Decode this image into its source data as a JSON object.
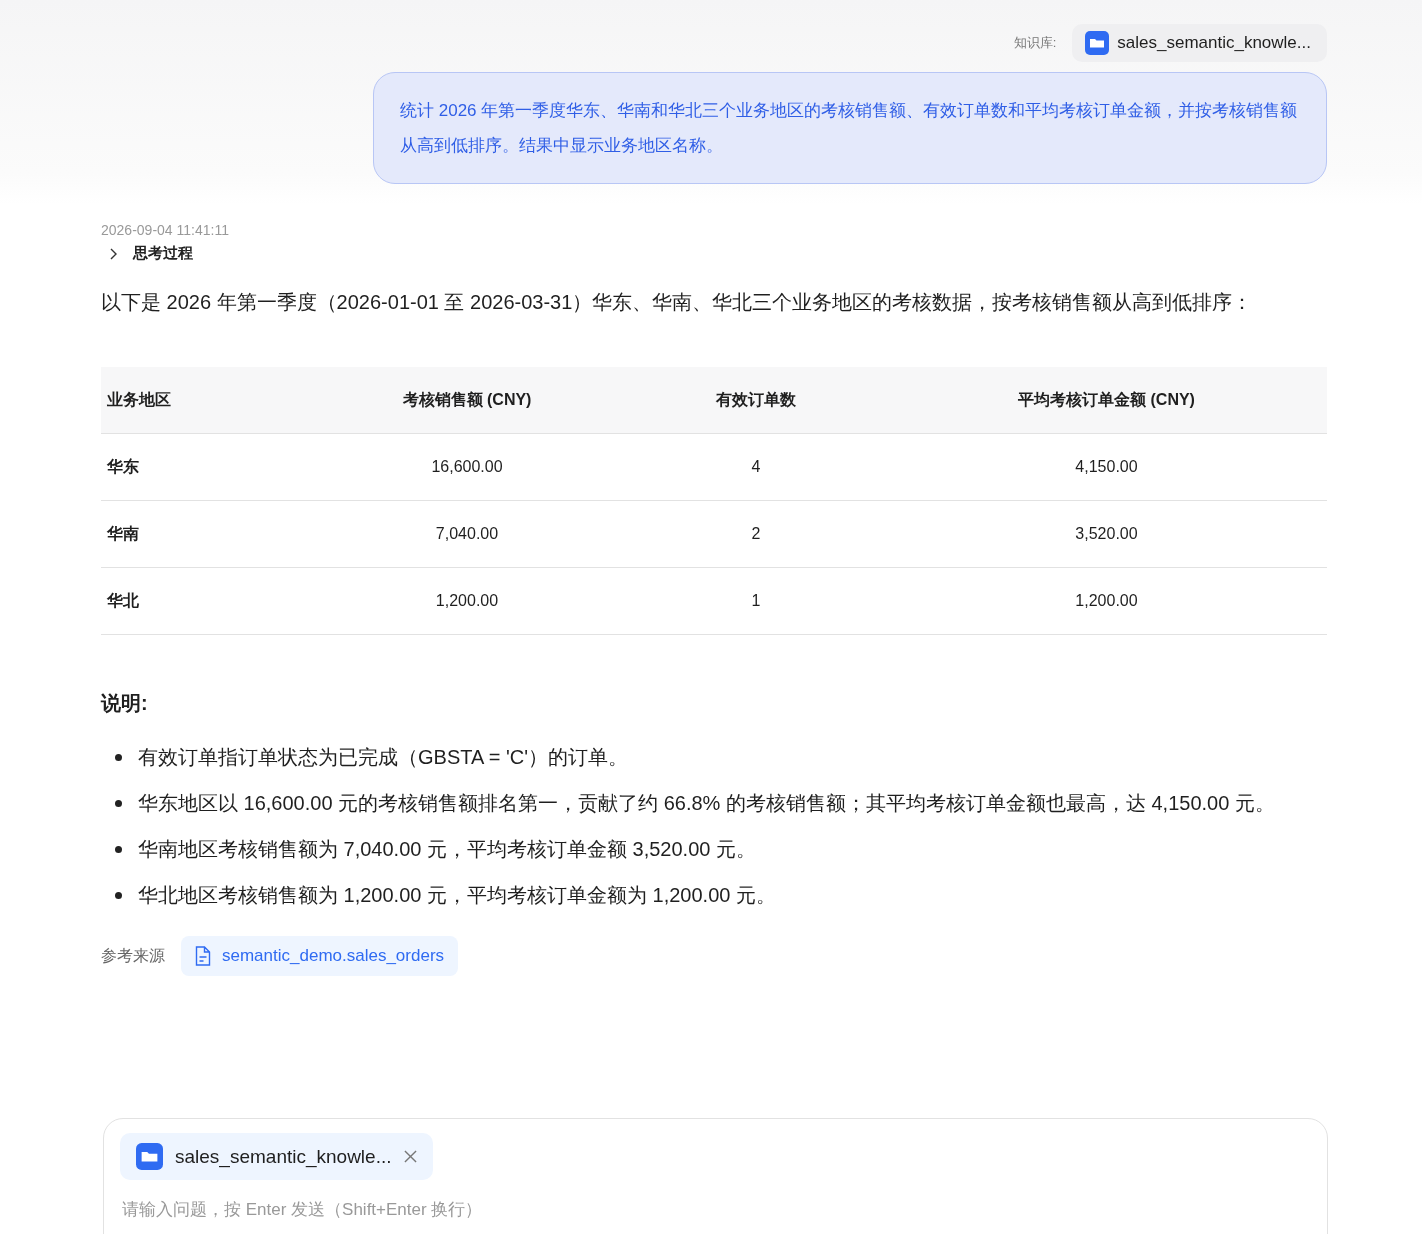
{
  "user_message": {
    "kb_label": "知识库:",
    "kb_name": "sales_semantic_knowle...",
    "text": "统计 2026 年第一季度华东、华南和华北三个业务地区的考核销售额、有效订单数和平均考核订单金额，并按考核销售额从高到低排序。结果中显示业务地区名称。"
  },
  "reply": {
    "timestamp": "2026-09-04 11:41:11",
    "thinking": {
      "label": "思考过程",
      "expanded": false
    },
    "intro": "以下是 2026 年第一季度（2026-01-01 至 2026-03-31）华东、华南、华北三个业务地区的考核数据，按考核销售额从高到低排序：",
    "table": {
      "columns": [
        "业务地区",
        "考核销售额 (CNY)",
        "有效订单数",
        "平均考核订单金额 (CNY)"
      ],
      "rows": [
        [
          "华东",
          "16,600.00",
          "4",
          "4,150.00"
        ],
        [
          "华南",
          "7,040.00",
          "2",
          "3,520.00"
        ],
        [
          "华北",
          "1,200.00",
          "1",
          "1,200.00"
        ]
      ]
    },
    "notes_title": "说明:",
    "notes": [
      "有效订单指订单状态为已完成（GBSTA = 'C'）的订单。",
      "华东地区以 16,600.00 元的考核销售额排名第一，贡献了约 66.8% 的考核销售额；其平均考核订单金额也最高，达 4,150.00 元。",
      "华南地区考核销售额为 7,040.00 元，平均考核订单金额 3,520.00 元。",
      "华北地区考核销售额为 1,200.00 元，平均考核订单金额为 1,200.00 元。"
    ],
    "sources_label": "参考来源",
    "sources": [
      "semantic_demo.sales_orders"
    ]
  },
  "composer": {
    "kb_chip": "sales_semantic_knowle...",
    "placeholder": "请输入问题，按 Enter 发送（Shift+Enter 换行）"
  }
}
